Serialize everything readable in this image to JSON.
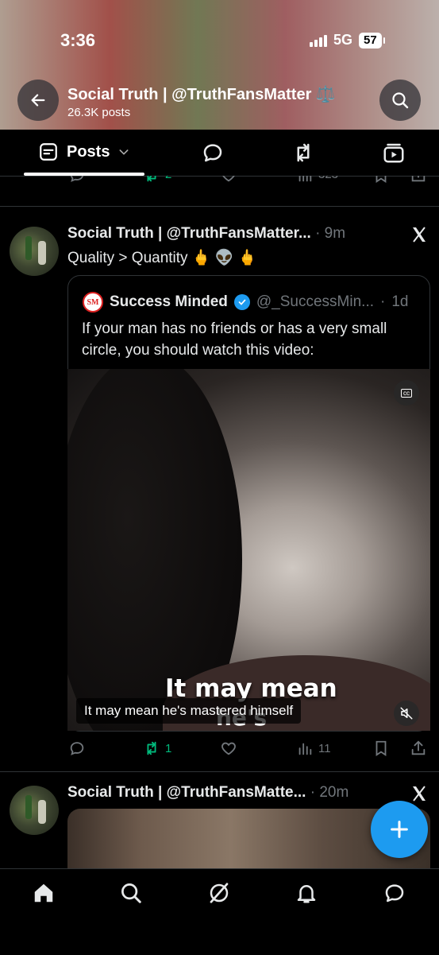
{
  "status_bar": {
    "time": "3:36",
    "network": "5G",
    "battery": "57"
  },
  "profile_header": {
    "title": "Social Truth | @TruthFansMatter",
    "title_emoji": "⚖️",
    "posts_count": "26.3K posts"
  },
  "tabs": {
    "active_label": "Posts"
  },
  "partial_row": {
    "retweets": "2",
    "views": "323"
  },
  "post1": {
    "author": "Social Truth | @TruthFansMatter...",
    "time": "9m",
    "text": "Quality > Quantity 🖕 👽 🖕",
    "quote": {
      "logo_text": "SM",
      "name": "Success Minded",
      "handle": "@_SuccessMin...",
      "time": "1d",
      "text": "If your man has no friends or has a very small circle, you should watch this video:"
    },
    "video": {
      "caption_big_line1": "It may mean",
      "caption_big_line2": "he's",
      "caption_small": "It may mean he's mastered himself",
      "cc_label": "cc"
    },
    "actions": {
      "retweets": "1",
      "views": "11"
    }
  },
  "post2": {
    "author": "Social Truth | @TruthFansMatte...",
    "time": "20m"
  },
  "colors": {
    "accent": "#1d9bf0",
    "retweet": "#00ba7c",
    "muted": "#71767b",
    "border": "#2f3336"
  },
  "icons": [
    "back-arrow-icon",
    "search-icon",
    "posts-tab-icon",
    "chevron-down-icon",
    "reply-icon",
    "retweet-icon",
    "media-tab-icon",
    "x-logo-icon",
    "like-icon",
    "views-icon",
    "bookmark-icon",
    "share-icon",
    "plus-icon",
    "home-icon",
    "grok-icon",
    "bell-icon",
    "messages-icon",
    "verified-icon",
    "mute-icon"
  ]
}
